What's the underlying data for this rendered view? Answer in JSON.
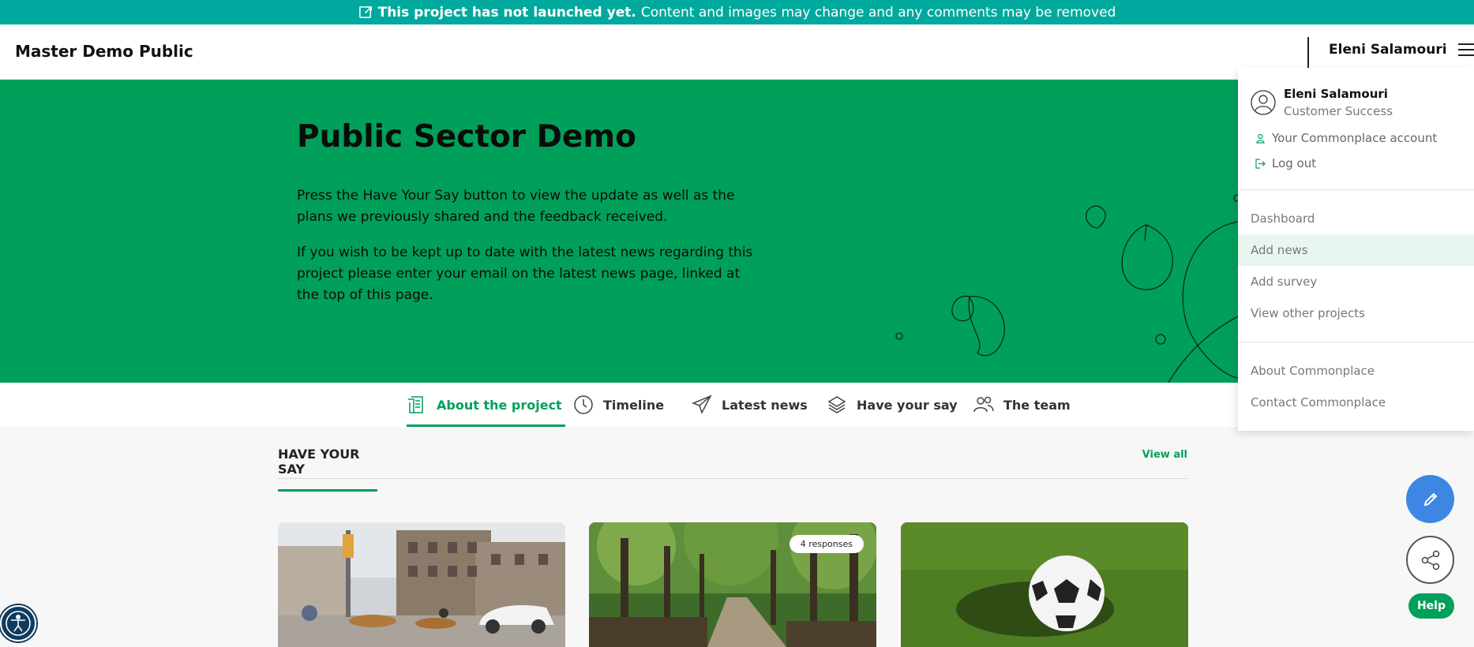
{
  "banner": {
    "strong": "This project has not launched yet.",
    "text": "Content and images may change and any comments may be removed"
  },
  "header": {
    "site_title": "Master Demo Public",
    "user_name": "Eleni Salamouri"
  },
  "hero": {
    "title": "Public Sector Demo",
    "paragraph1": "Press the Have Your Say button to view the update as well as the plans we previously shared and the feedback received.",
    "paragraph2": "If you wish to be kept up to date with the latest news regarding this project please enter your email on the latest news page, linked at the top of this page."
  },
  "tabs": [
    {
      "label": "About the project",
      "icon": "document-icon",
      "active": true
    },
    {
      "label": "Timeline",
      "icon": "clock-icon",
      "active": false
    },
    {
      "label": "Latest news",
      "icon": "paper-plane-icon",
      "active": false
    },
    {
      "label": "Have your say",
      "icon": "layers-icon",
      "active": false
    },
    {
      "label": "The team",
      "icon": "people-icon",
      "active": false
    }
  ],
  "section": {
    "title": "HAVE YOUR SAY",
    "view_all": "View all"
  },
  "cards": [
    {
      "image": "street-scene",
      "badge": ""
    },
    {
      "image": "woodland-path",
      "badge": "4 responses"
    },
    {
      "image": "football-on-grass",
      "badge": ""
    }
  ],
  "dropdown": {
    "name": "Eleni Salamouri",
    "role": "Customer Success",
    "account_link": "Your Commonplace account",
    "logout_link": "Log out",
    "items": [
      "Dashboard",
      "Add news",
      "Add survey",
      "View other projects"
    ],
    "footer_items": [
      "About Commonplace",
      "Contact Commonplace"
    ]
  },
  "help_label": "Help",
  "colors": {
    "banner": "#00a99d",
    "hero": "#00a05a",
    "accent": "#00a05a",
    "fab_edit": "#3e86e4",
    "a11y": "#0f3b5f"
  }
}
